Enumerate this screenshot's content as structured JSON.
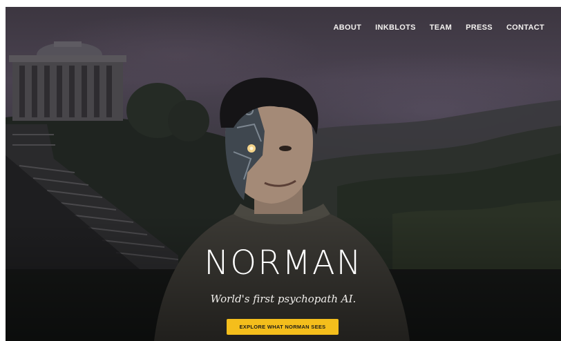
{
  "nav": {
    "items": [
      {
        "label": "ABOUT"
      },
      {
        "label": "INKBLOTS"
      },
      {
        "label": "TEAM"
      },
      {
        "label": "PRESS"
      },
      {
        "label": "CONTACT"
      }
    ]
  },
  "hero": {
    "title": "NORMAN",
    "subtitle": "World's first psychopath AI.",
    "cta_label": "EXPLORE WHAT NORMAN SEES"
  },
  "colors": {
    "cta_background": "#f4be1c",
    "text": "#ffffff"
  }
}
